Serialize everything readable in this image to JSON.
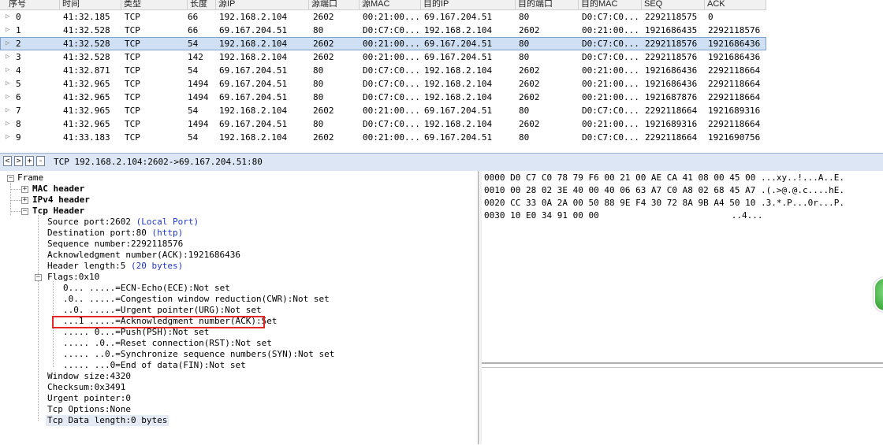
{
  "packet_list": {
    "columns": [
      "序号",
      "时间",
      "类型",
      "长度",
      "源IP",
      "源端口",
      "源MAC",
      "目的IP",
      "目的端口",
      "目的MAC",
      "SEQ",
      "ACK"
    ],
    "rows": [
      {
        "no": "0",
        "time": "41:32.185",
        "type": "TCP",
        "len": "66",
        "src_ip": "192.168.2.104",
        "src_port": "2602",
        "src_mac": "00:21:00...",
        "dst_ip": "69.167.204.51",
        "dst_port": "80",
        "dst_mac": "D0:C7:C0...",
        "seq": "2292118575",
        "ack": "0"
      },
      {
        "no": "1",
        "time": "41:32.528",
        "type": "TCP",
        "len": "66",
        "src_ip": "69.167.204.51",
        "src_port": "80",
        "src_mac": "D0:C7:C0...",
        "dst_ip": "192.168.2.104",
        "dst_port": "2602",
        "dst_mac": "00:21:00...",
        "seq": "1921686435",
        "ack": "2292118576"
      },
      {
        "no": "2",
        "time": "41:32.528",
        "type": "TCP",
        "len": "54",
        "src_ip": "192.168.2.104",
        "src_port": "2602",
        "src_mac": "00:21:00...",
        "dst_ip": "69.167.204.51",
        "dst_port": "80",
        "dst_mac": "D0:C7:C0...",
        "seq": "2292118576",
        "ack": "1921686436",
        "selected": true
      },
      {
        "no": "3",
        "time": "41:32.528",
        "type": "TCP",
        "len": "142",
        "src_ip": "192.168.2.104",
        "src_port": "2602",
        "src_mac": "00:21:00...",
        "dst_ip": "69.167.204.51",
        "dst_port": "80",
        "dst_mac": "D0:C7:C0...",
        "seq": "2292118576",
        "ack": "1921686436"
      },
      {
        "no": "4",
        "time": "41:32.871",
        "type": "TCP",
        "len": "54",
        "src_ip": "69.167.204.51",
        "src_port": "80",
        "src_mac": "D0:C7:C0...",
        "dst_ip": "192.168.2.104",
        "dst_port": "2602",
        "dst_mac": "00:21:00...",
        "seq": "1921686436",
        "ack": "2292118664"
      },
      {
        "no": "5",
        "time": "41:32.965",
        "type": "TCP",
        "len": "1494",
        "src_ip": "69.167.204.51",
        "src_port": "80",
        "src_mac": "D0:C7:C0...",
        "dst_ip": "192.168.2.104",
        "dst_port": "2602",
        "dst_mac": "00:21:00...",
        "seq": "1921686436",
        "ack": "2292118664"
      },
      {
        "no": "6",
        "time": "41:32.965",
        "type": "TCP",
        "len": "1494",
        "src_ip": "69.167.204.51",
        "src_port": "80",
        "src_mac": "D0:C7:C0...",
        "dst_ip": "192.168.2.104",
        "dst_port": "2602",
        "dst_mac": "00:21:00...",
        "seq": "1921687876",
        "ack": "2292118664"
      },
      {
        "no": "7",
        "time": "41:32.965",
        "type": "TCP",
        "len": "54",
        "src_ip": "192.168.2.104",
        "src_port": "2602",
        "src_mac": "00:21:00...",
        "dst_ip": "69.167.204.51",
        "dst_port": "80",
        "dst_mac": "D0:C7:C0...",
        "seq": "2292118664",
        "ack": "1921689316"
      },
      {
        "no": "8",
        "time": "41:32.965",
        "type": "TCP",
        "len": "1494",
        "src_ip": "69.167.204.51",
        "src_port": "80",
        "src_mac": "D0:C7:C0...",
        "dst_ip": "192.168.2.104",
        "dst_port": "2602",
        "dst_mac": "00:21:00...",
        "seq": "1921689316",
        "ack": "2292118664"
      },
      {
        "no": "9",
        "time": "41:33.183",
        "type": "TCP",
        "len": "54",
        "src_ip": "192.168.2.104",
        "src_port": "2602",
        "src_mac": "00:21:00...",
        "dst_ip": "69.167.204.51",
        "dst_port": "80",
        "dst_mac": "D0:C7:C0...",
        "seq": "2292118664",
        "ack": "1921690756"
      }
    ]
  },
  "toolbar": {
    "buttons": [
      "<",
      ">",
      "+",
      "-"
    ],
    "summary": "TCP 192.168.2.104:2602->69.167.204.51:80"
  },
  "tree": {
    "frame": "Frame",
    "mac_header": "MAC header",
    "ipv4_header": "IPv4 header",
    "tcp_header": "Tcp Header",
    "source_port": "Source port:2602",
    "source_port_note": "(Local Port)",
    "dest_port": "Destination port:80",
    "dest_port_note": "(http)",
    "seq": "Sequence number:2292118576",
    "ack": "Acknowledgment number(ACK):1921686436",
    "header_len": "Header length:5",
    "header_len_note": "(20 bytes)",
    "flags": "Flags:0x10",
    "flag_ece": "0... .....=ECN-Echo(ECE):Not set",
    "flag_cwr": ".0.. .....=Congestion window reduction(CWR):Not set",
    "flag_urg": "..0. .....=Urgent pointer(URG):Not set",
    "flag_ack": "...1 .....=Acknowledgment number(ACK):Set",
    "flag_psh": "..... 0...=Push(PSH):Not set",
    "flag_rst": "..... .0..=Reset connection(RST):Not set",
    "flag_syn": "..... ..0.=Synchronize sequence numbers(SYN):Not set",
    "flag_fin": "..... ...0=End of data(FIN):Not set",
    "window": "Window size:4320",
    "checksum": "Checksum:0x3491",
    "urgent": "Urgent pointer:0",
    "options": "Tcp Options:None",
    "data_len": "Tcp Data length:0 bytes"
  },
  "hex": {
    "rows": [
      {
        "offset": "0000",
        "bytes": "D0 C7 C0 78 79 F6 00 21 00 AE CA 41 08 00 45 00",
        "ascii": "...xy..!...A..E."
      },
      {
        "offset": "0010",
        "bytes": "00 28 02 3E 40 00 40 06 63 A7 C0 A8 02 68 45 A7",
        "ascii": ".(.>@.@.c....hE."
      },
      {
        "offset": "0020",
        "bytes": "CC 33 0A 2A 00 50 88 9E F4 30 72 8A 9B A4 50 10",
        "ascii": ".3.*.P...0r...P."
      },
      {
        "offset": "0030",
        "bytes": "10 E0 34 91 00 00",
        "ascii": "..4..."
      }
    ]
  }
}
